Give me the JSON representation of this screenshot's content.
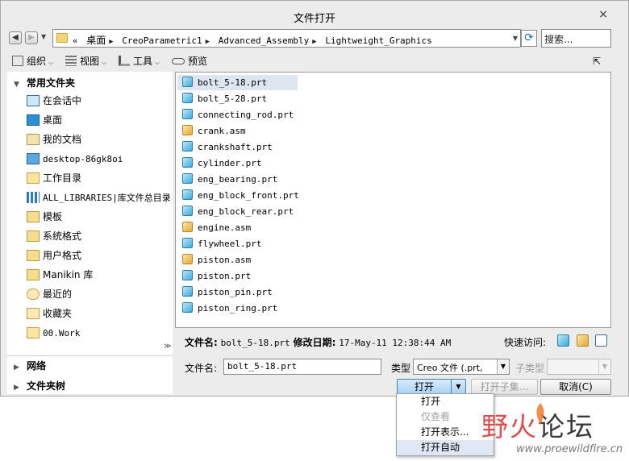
{
  "window": {
    "title": "文件打开",
    "close_glyph": "×"
  },
  "navigation": {
    "back_icon": "left-arrow-icon",
    "forward_icon": "right-arrow-icon",
    "breadcrumb_prefix": "«",
    "breadcrumbs": [
      "桌面",
      "CreoParametric1",
      "Advanced_Assembly",
      "Lightweight_Graphics"
    ],
    "search_placeholder": "搜索..."
  },
  "toolbar": {
    "organize": "组织",
    "view": "视图",
    "tools": "工具",
    "preview": "预览"
  },
  "sidebar": {
    "common_header": "常用文件夹",
    "items": [
      {
        "label": "在会话中",
        "icon": "session-monitor-icon"
      },
      {
        "label": "桌面",
        "icon": "desktop-icon"
      },
      {
        "label": "我的文档",
        "icon": "documents-icon"
      },
      {
        "label": "desktop-86gk8oi",
        "icon": "computer-icon"
      },
      {
        "label": "工作目录",
        "icon": "working-directory-icon"
      },
      {
        "label": "ALL_LIBRARIES|库文件总目录",
        "icon": "library-icon"
      },
      {
        "label": "模板",
        "icon": "template-folder-icon"
      },
      {
        "label": "系统格式",
        "icon": "system-format-folder-icon"
      },
      {
        "label": "用户格式",
        "icon": "user-format-folder-icon"
      },
      {
        "label": "Manikin 库",
        "icon": "manikin-folder-icon"
      },
      {
        "label": "最近的",
        "icon": "recent-icon"
      },
      {
        "label": "收藏夹",
        "icon": "favorites-icon"
      },
      {
        "label": "00.Work",
        "icon": "folder-icon"
      }
    ],
    "network_header": "网络",
    "tree_header": "文件夹树"
  },
  "files": [
    {
      "name": "bolt_5-18.prt",
      "kind": "prt",
      "selected": true
    },
    {
      "name": "bolt_5-28.prt",
      "kind": "prt"
    },
    {
      "name": "connecting_rod.prt",
      "kind": "prt"
    },
    {
      "name": "crank.asm",
      "kind": "asm"
    },
    {
      "name": "crankshaft.prt",
      "kind": "prt"
    },
    {
      "name": "cylinder.prt",
      "kind": "prt"
    },
    {
      "name": "eng_bearing.prt",
      "kind": "prt"
    },
    {
      "name": "eng_block_front.prt",
      "kind": "prt"
    },
    {
      "name": "eng_block_rear.prt",
      "kind": "prt"
    },
    {
      "name": "engine.asm",
      "kind": "asm"
    },
    {
      "name": "flywheel.prt",
      "kind": "prt"
    },
    {
      "name": "piston.asm",
      "kind": "asm"
    },
    {
      "name": "piston.prt",
      "kind": "prt"
    },
    {
      "name": "piston_pin.prt",
      "kind": "prt"
    },
    {
      "name": "piston_ring.prt",
      "kind": "prt"
    }
  ],
  "info": {
    "filename_label": "文件名:",
    "filename_value": "bolt_5-18.prt",
    "modified_label": "修改日期:",
    "modified_value": "17-May-11 12:38:44 AM",
    "quick_access_label": "快速访问:"
  },
  "form": {
    "filename_label": "文件名:",
    "filename_value": "bolt_5-18.prt",
    "type_label": "类型",
    "type_value": "Creo 文件 (.prt,",
    "subtype_label": "子类型",
    "subtype_value": ""
  },
  "buttons": {
    "open": "打开",
    "open_subset": "打开子集...",
    "cancel": "取消(C)"
  },
  "open_menu": [
    {
      "label": "打开",
      "disabled": false
    },
    {
      "label": "仅查看",
      "disabled": true
    },
    {
      "label": "打开表示...",
      "disabled": false
    },
    {
      "label": "打开自动",
      "disabled": false,
      "highlighted": true
    }
  ],
  "watermark": {
    "text_part1": "野火",
    "text_part2": "论坛",
    "url": "www.proewildfire.cn"
  },
  "colors": {
    "dialog_bg": "#ececec",
    "selection": "#dde5ee",
    "accent_blue": "#1874c4",
    "watermark_red": "#e24b4b"
  }
}
